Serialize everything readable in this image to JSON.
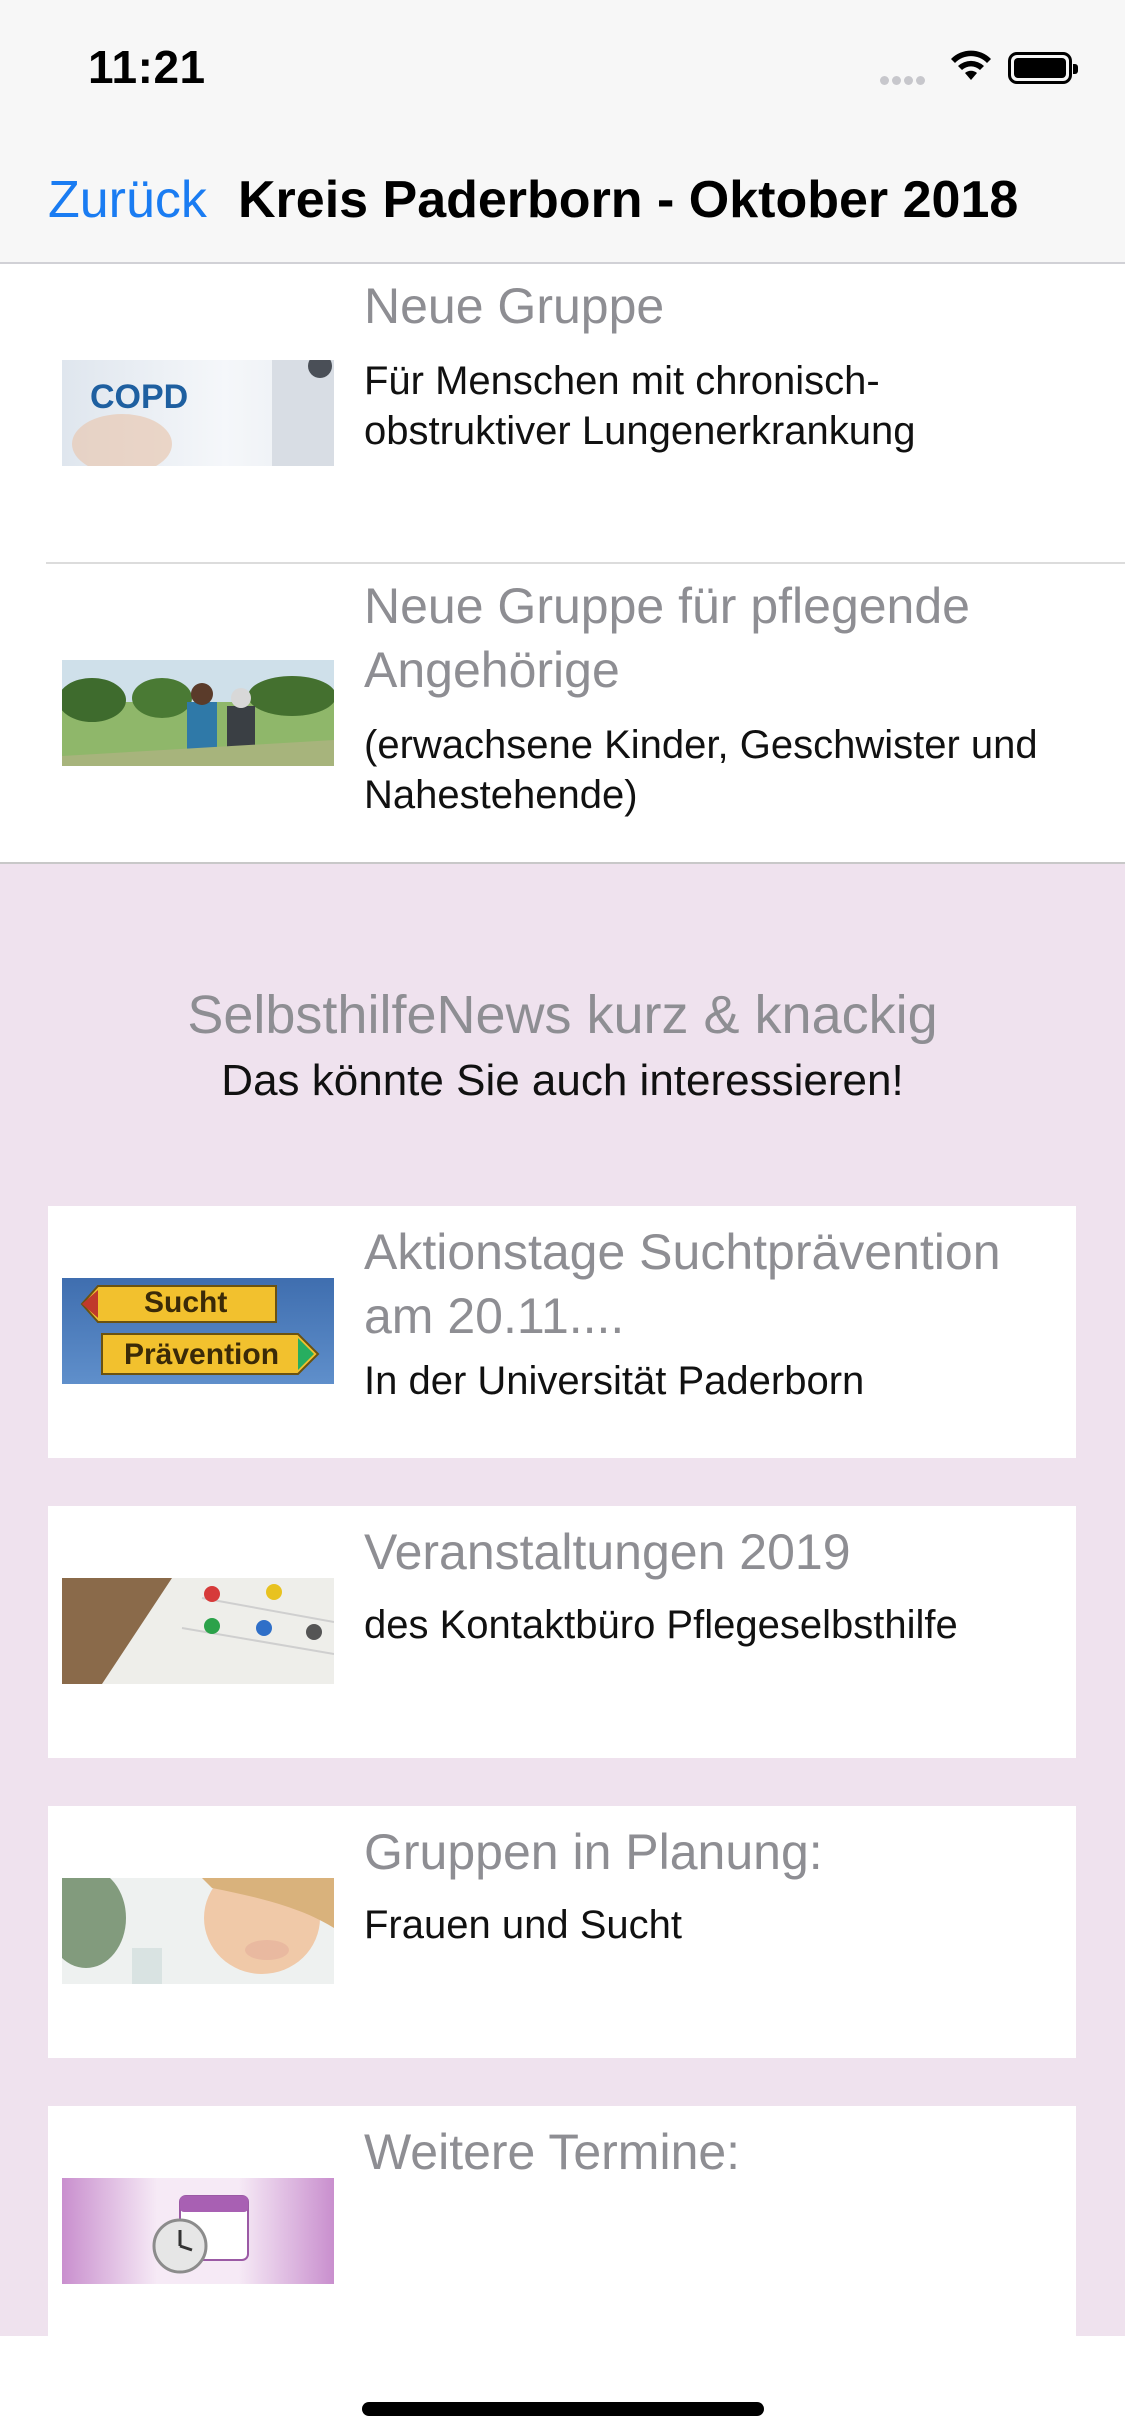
{
  "status_bar": {
    "time": "11:21"
  },
  "nav": {
    "back_label": "Zurück",
    "title": "Kreis Paderborn - Oktober 2018"
  },
  "top_items": [
    {
      "title": "Neue Gruppe",
      "description": "Für Menschen mit chronisch-obstruktiver Lungenerkrankung",
      "image_label": "COPD"
    },
    {
      "title": "Neue Gruppe für pflegende Angehörige",
      "description": "(erwachsene Kinder, Geschwister und Nahestehende)"
    }
  ],
  "news": {
    "title": "SelbsthilfeNews kurz & knackig",
    "subtitle": "Das könnte Sie auch interessieren!",
    "items": [
      {
        "title": "Aktionstage Suchtprävention am 20.11....",
        "description": "In der Universität Paderborn",
        "sign_top": "Sucht",
        "sign_bottom": "Prävention"
      },
      {
        "title": "Veranstaltungen 2019",
        "description": "des Kontaktbüro Pflegeselbsthilfe"
      },
      {
        "title": "Gruppen in Planung:",
        "description": "Frauen und Sucht"
      },
      {
        "title": "Weitere Termine:",
        "description": ""
      }
    ]
  },
  "colors": {
    "accent": "#1a7cf2",
    "news_bg": "#efe2ee",
    "title_gray": "#8e8e93"
  }
}
